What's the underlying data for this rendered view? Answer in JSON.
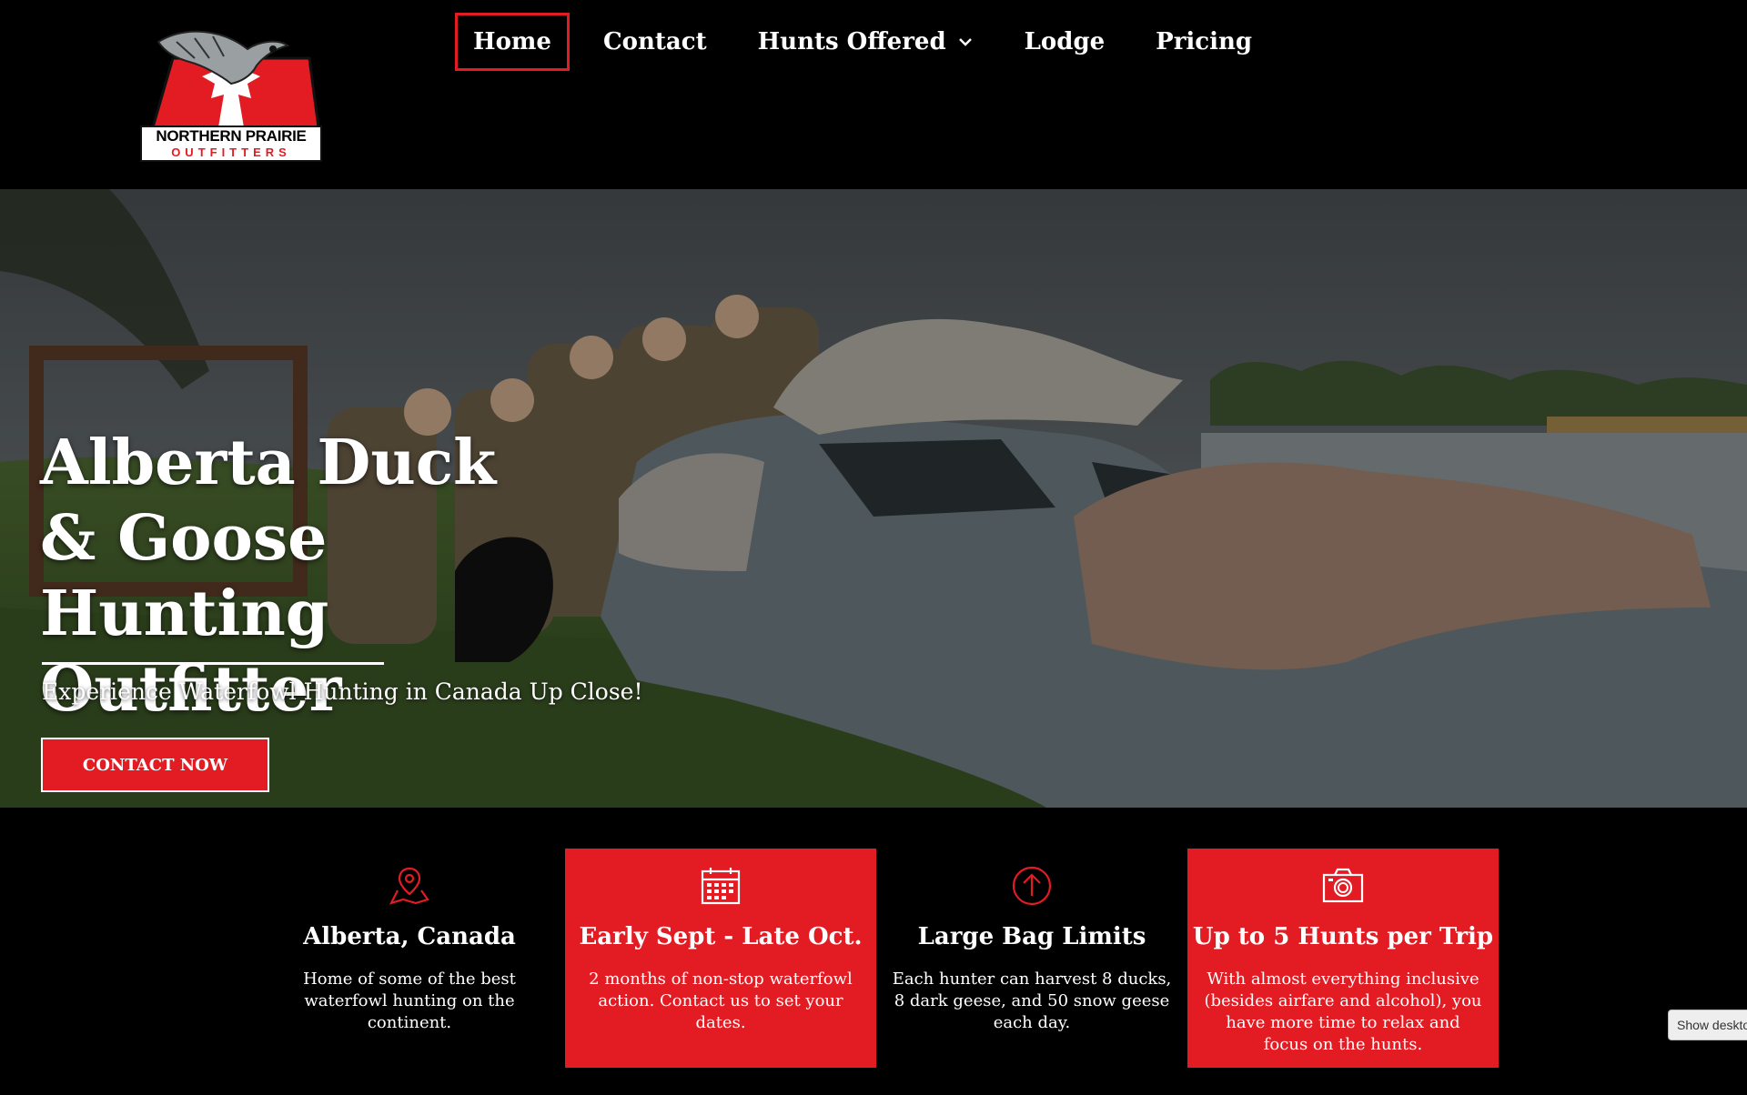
{
  "header": {
    "logo": {
      "line1": "NORTHERN PRAIRIE",
      "line2": "OUTFITTERS"
    },
    "nav": [
      {
        "label": "Home",
        "active": true
      },
      {
        "label": "Contact"
      },
      {
        "label": "Hunts Offered",
        "dropdown": true
      },
      {
        "label": "Lodge"
      },
      {
        "label": "Pricing"
      }
    ]
  },
  "hero": {
    "title": "Alberta Duck & Goose Hunting Outfitter",
    "subtitle": "Experience Waterfowl Hunting in Canada Up Close!",
    "cta": "CONTACT NOW"
  },
  "features": [
    {
      "icon": "map-pin-icon",
      "title": "Alberta, Canada",
      "desc": "Home of some of the best waterfowl hunting on the continent.",
      "highlight": false
    },
    {
      "icon": "calendar-icon",
      "title": "Early Sept - Late Oct.",
      "desc": "2 months of non-stop waterfowl action.  Contact us to set your dates.",
      "highlight": true
    },
    {
      "icon": "arrow-up-circle-icon",
      "title": "Large Bag Limits",
      "desc": "Each hunter can harvest 8 ducks, 8 dark geese, and 50 snow geese each day.",
      "highlight": false
    },
    {
      "icon": "camera-icon",
      "title": "Up to 5 Hunts per Trip",
      "desc": "With almost everything inclusive (besides airfare and alcohol), you have more time to relax and focus on the hunts.",
      "highlight": true
    }
  ],
  "show_desktop": "Show desktop",
  "colors": {
    "accent": "#e31b23",
    "background": "#000000",
    "text": "#ffffff"
  }
}
